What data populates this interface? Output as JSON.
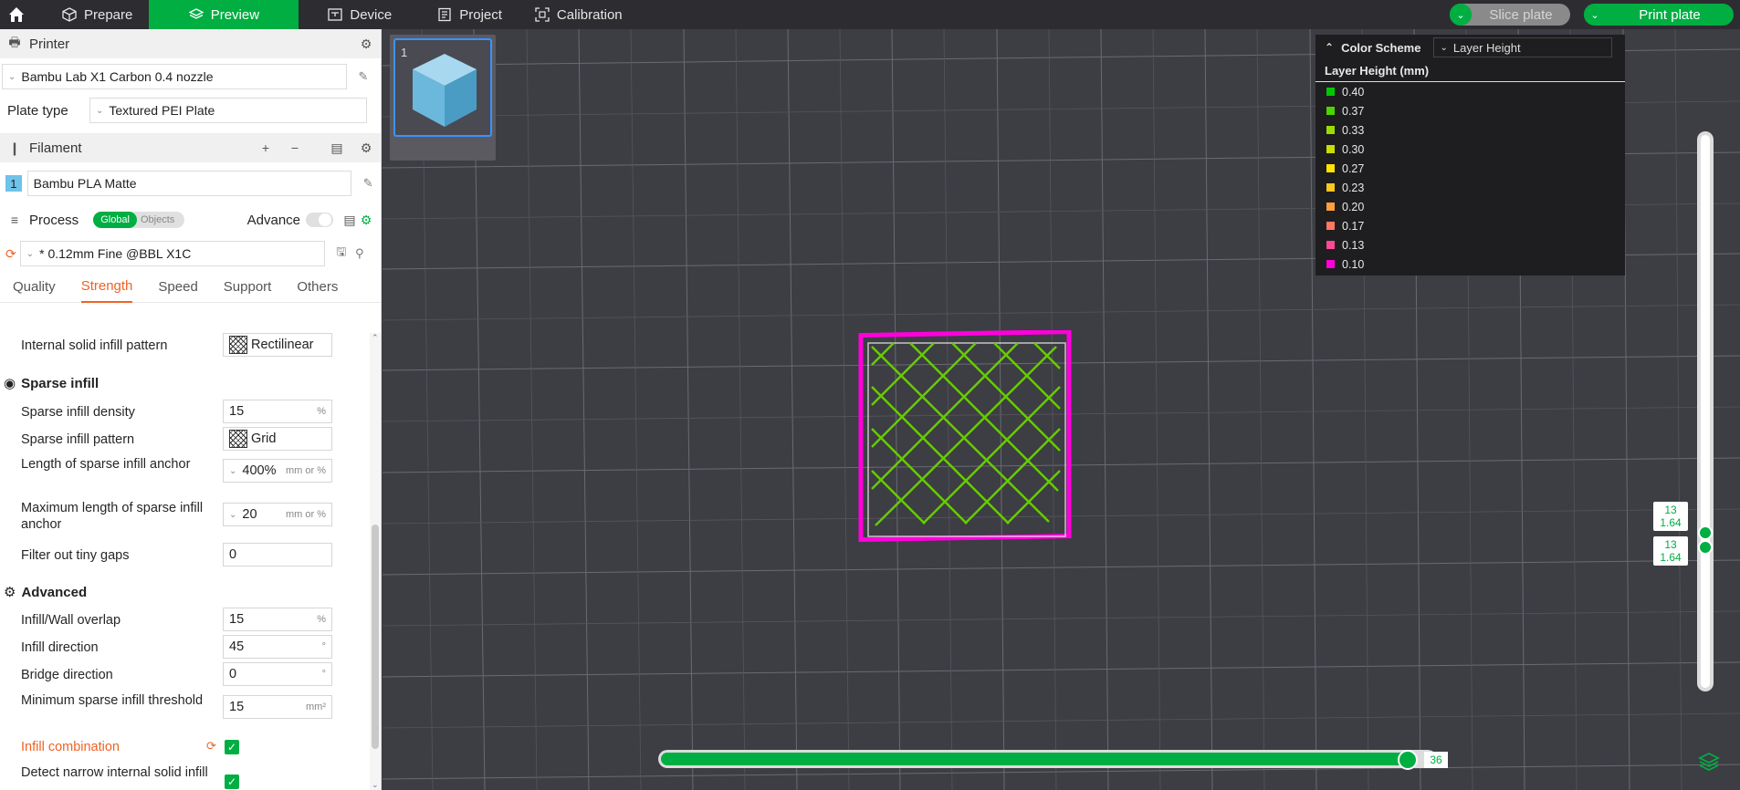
{
  "topbar": {
    "tabs": [
      {
        "label": "Prepare",
        "icon": "cube-outline-icon"
      },
      {
        "label": "Preview",
        "icon": "layers-icon",
        "active": true
      },
      {
        "label": "Device",
        "icon": "device-icon"
      },
      {
        "label": "Project",
        "icon": "project-icon"
      },
      {
        "label": "Calibration",
        "icon": "calibration-icon"
      }
    ],
    "slice_label": "Slice plate",
    "print_label": "Print plate"
  },
  "printer": {
    "section_title": "Printer",
    "printer_name": "Bambu Lab X1 Carbon 0.4 nozzle",
    "plate_type_label": "Plate type",
    "plate_type_value": "Textured PEI Plate"
  },
  "filament": {
    "section_title": "Filament",
    "slot_number": "1",
    "filament_name": "Bambu PLA Matte"
  },
  "process": {
    "section_title": "Process",
    "toggle_global": "Global",
    "toggle_objects": "Objects",
    "advance_label": "Advance",
    "preset_name": "* 0.12mm Fine @BBL X1C",
    "tabs": [
      "Quality",
      "Strength",
      "Speed",
      "Support",
      "Others"
    ],
    "active_tab": "Strength"
  },
  "settings": {
    "internal_solid_infill_pattern": {
      "label": "Internal solid infill pattern",
      "value": "Rectilinear"
    },
    "sparse_infill_group": "Sparse infill",
    "sparse_infill_density": {
      "label": "Sparse infill density",
      "value": "15",
      "unit": "%"
    },
    "sparse_infill_pattern": {
      "label": "Sparse infill pattern",
      "value": "Grid"
    },
    "sparse_infill_anchor": {
      "label": "Length of sparse infill anchor",
      "value": "400%",
      "unit": "mm or %"
    },
    "sparse_infill_anchor_max": {
      "label": "Maximum length of sparse infill anchor",
      "value": "20",
      "unit": "mm or %"
    },
    "filter_tiny_gaps": {
      "label": "Filter out tiny gaps",
      "value": "0"
    },
    "advanced_group": "Advanced",
    "infill_wall_overlap": {
      "label": "Infill/Wall overlap",
      "value": "15",
      "unit": "%"
    },
    "infill_direction": {
      "label": "Infill direction",
      "value": "45",
      "unit": "°"
    },
    "bridge_direction": {
      "label": "Bridge direction",
      "value": "0",
      "unit": "°"
    },
    "min_sparse_infill_threshold": {
      "label": "Minimum sparse infill threshold",
      "value": "15",
      "unit": "mm²"
    },
    "infill_combination": {
      "label": "Infill combination",
      "checked": true
    },
    "detect_narrow_internal_solid": {
      "label": "Detect narrow internal solid infill",
      "checked": true
    }
  },
  "viewport": {
    "plate_number": "1",
    "legend": {
      "color_scheme_label": "Color Scheme",
      "color_scheme_value": "Layer Height",
      "title": "Layer Height (mm)",
      "items": [
        {
          "value": "0.40",
          "color": "#00c800"
        },
        {
          "value": "0.37",
          "color": "#4ad400"
        },
        {
          "value": "0.33",
          "color": "#99dd00"
        },
        {
          "value": "0.30",
          "color": "#ccdd00"
        },
        {
          "value": "0.27",
          "color": "#ffe400"
        },
        {
          "value": "0.23",
          "color": "#ffc81e"
        },
        {
          "value": "0.20",
          "color": "#ffa03c"
        },
        {
          "value": "0.17",
          "color": "#ff7864"
        },
        {
          "value": "0.13",
          "color": "#ff4896"
        },
        {
          "value": "0.10",
          "color": "#ff00dc"
        }
      ]
    },
    "layer_slider": {
      "upper": {
        "layer": "13",
        "height": "1.64"
      },
      "lower": {
        "layer": "13",
        "height": "1.64"
      }
    },
    "move_slider_value": "36"
  },
  "colors": {
    "accent": "#00ae42",
    "active_tab": "#f06224",
    "modified_label": "#f06224"
  }
}
